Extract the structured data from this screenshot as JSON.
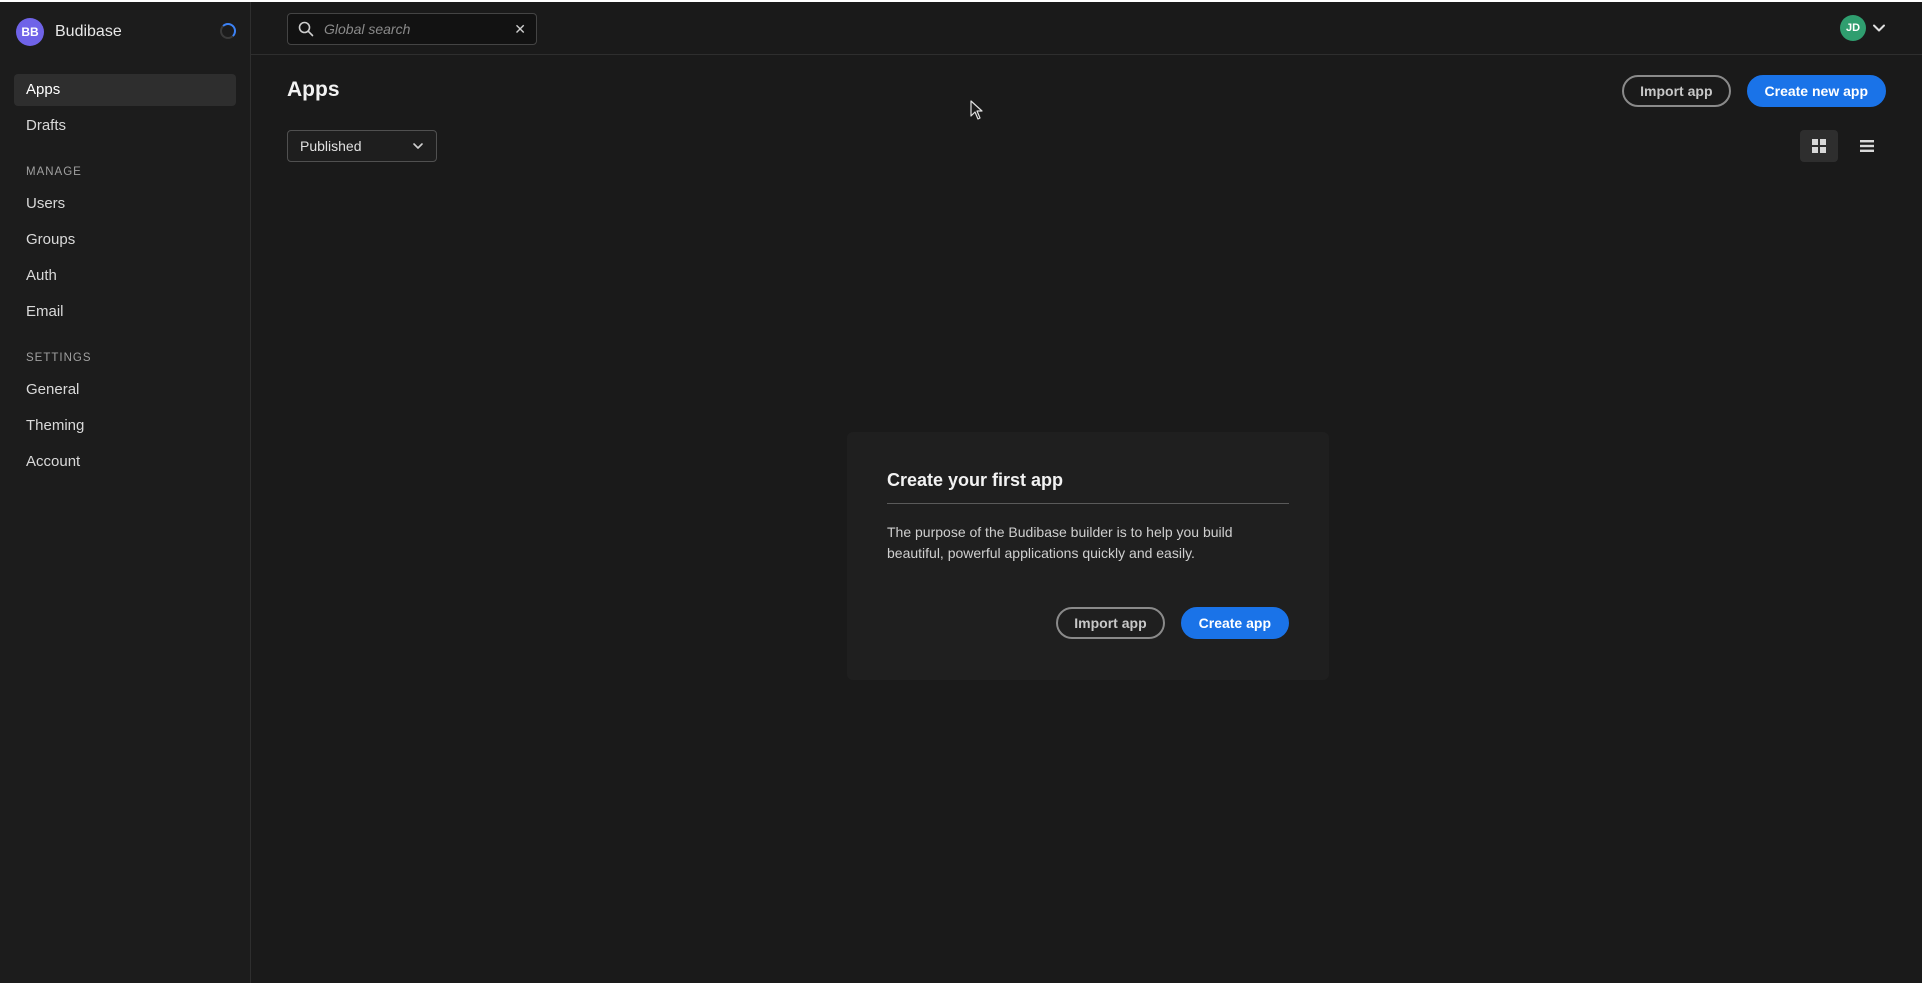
{
  "brand": {
    "initials": "BB",
    "name": "Budibase",
    "avatar_color": "#6f63e8"
  },
  "sidebar": {
    "items": [
      {
        "label": "Apps",
        "active": true
      },
      {
        "label": "Drafts",
        "active": false
      }
    ],
    "manage_label": "MANAGE",
    "manage_items": [
      {
        "label": "Users"
      },
      {
        "label": "Groups"
      },
      {
        "label": "Auth"
      },
      {
        "label": "Email"
      }
    ],
    "settings_label": "SETTINGS",
    "settings_items": [
      {
        "label": "General"
      },
      {
        "label": "Theming"
      },
      {
        "label": "Account"
      }
    ]
  },
  "topbar": {
    "search_placeholder": "Global search",
    "clear_icon": "close-icon",
    "user_initials": "JD",
    "user_color": "#2f9e6f"
  },
  "page": {
    "title": "Apps",
    "import_label": "Import app",
    "create_label": "Create new app",
    "filter_value": "Published",
    "view_modes": [
      "grid-icon",
      "list-icon"
    ],
    "active_view": "grid"
  },
  "empty_state": {
    "title": "Create your first app",
    "description": "The purpose of the Budibase builder is to help you build beautiful, powerful applications quickly and easily.",
    "import_label": "Import app",
    "create_label": "Create app"
  },
  "colors": {
    "accent": "#1a73e8",
    "background": "#1a1a1a",
    "sidebar": "#1c1c1c"
  }
}
